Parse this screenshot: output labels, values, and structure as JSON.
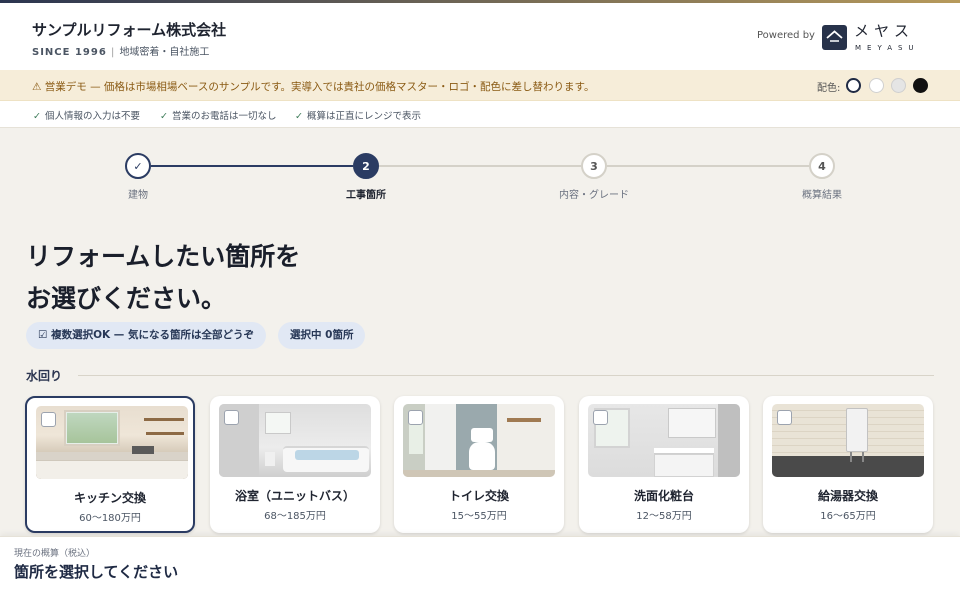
{
  "header": {
    "company": "サンプルリフォーム株式会社",
    "since": "SINCE 1996",
    "area": "地域密着・自社施工",
    "powered_by": "Powered by",
    "logo_kana": "メヤス",
    "logo_roman": "MEYASU"
  },
  "notice": {
    "text": "⚠ 営業デモ — 価格は市場相場ベースのサンプルです。実導入では貴社の価格マスター・ロゴ・配色に差し替わります。",
    "color_label": "配色:",
    "swatches": [
      "#1f2a44",
      "#ffffff",
      "#e5e5e5",
      "#111111"
    ]
  },
  "trust": [
    "個人情報の入力は不要",
    "営業のお電話は一切なし",
    "概算は正直にレンジで表示"
  ],
  "steps": [
    {
      "number": "✓",
      "label": "建物"
    },
    {
      "number": "2",
      "label": "工事箇所"
    },
    {
      "number": "3",
      "label": "内容・グレード"
    },
    {
      "number": "4",
      "label": "概算結果"
    }
  ],
  "heading": {
    "line1": "リフォームしたい箇所を",
    "line2": "お選びください。"
  },
  "chips": {
    "multi": "☑ 複数選択OK — 気になる箇所は全部どうぞ",
    "selected": "選択中 0箇所"
  },
  "section": {
    "title": "水回り"
  },
  "cards": [
    {
      "name": "キッチン交換",
      "price": "60〜180万円"
    },
    {
      "name": "浴室（ユニットバス）",
      "price": "68〜185万円"
    },
    {
      "name": "トイレ交換",
      "price": "15〜55万円"
    },
    {
      "name": "洗面化粧台",
      "price": "12〜58万円"
    },
    {
      "name": "給湯器交換",
      "price": "16〜65万円"
    }
  ],
  "footer": {
    "label": "現在の概算（税込）",
    "value": "箇所を選択してください"
  },
  "colors": {
    "navy": "#2b3c63",
    "notice_bg": "#f6edd9",
    "page_bg": "#f3f1ec"
  }
}
